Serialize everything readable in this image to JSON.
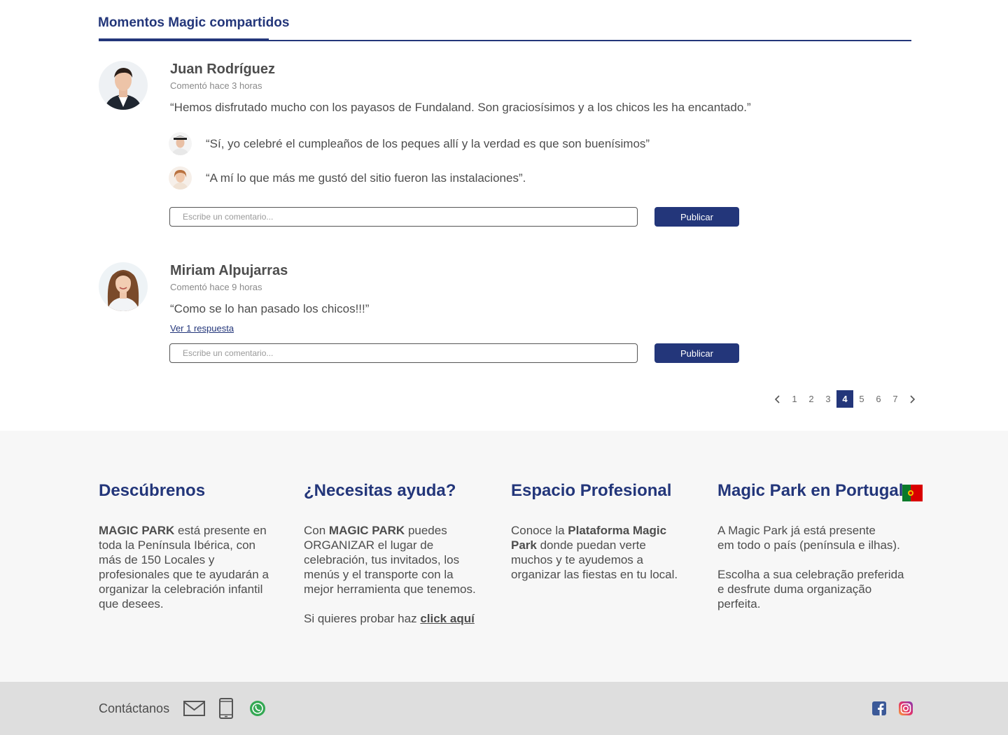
{
  "section": {
    "title": "Momentos Magic compartidos"
  },
  "comments": [
    {
      "author": "Juan Rodríguez",
      "meta": "Comentó hace 3 horas",
      "text": "“Hemos disfrutado mucho con los payasos de Fundaland. Son graciosísimos y a los chicos les ha encantado.”",
      "replies": [
        {
          "text": "“Sí, yo celebré el cumpleaños de los peques allí y la verdad es que son buenísimos”"
        },
        {
          "text": "“A mí lo que más me gustó del sitio fueron las instalaciones”."
        }
      ],
      "input_placeholder": "Escribe un comentario...",
      "publish_label": "Publicar"
    },
    {
      "author": "Miriam Alpujarras",
      "meta": "Comentó hace 9 horas",
      "text": "“Como se lo han pasado los chicos!!!”",
      "reply_link": "Ver 1 respuesta",
      "input_placeholder": "Escribe un comentario...",
      "publish_label": "Publicar"
    }
  ],
  "pagination": {
    "pages": [
      "1",
      "2",
      "3",
      "4",
      "5",
      "6",
      "7"
    ],
    "current": "4",
    "prev": "‹",
    "next": "›"
  },
  "footer": {
    "discover": {
      "title": "Descúbrenos",
      "brand": "MAGIC PARK",
      "text": " está presente en toda la Península Ibérica, con más de 150 Locales y profesionales que te ayudarán a organizar la celebración infantil que desees."
    },
    "help": {
      "title": "¿Necesitas ayuda?",
      "prefix": "Con ",
      "brand": "MAGIC PARK",
      "text": " puedes ORGANIZAR el lugar de celebración, tus invitados, los menús y el transporte con la mejor herramienta que tenemos.",
      "try_prefix": "Si quieres probar haz ",
      "try_link": "click aquí"
    },
    "professional": {
      "title": "Espacio Profesional",
      "prefix": "Conoce la ",
      "brand": "Plataforma Magic Park",
      "text": " donde puedan verte muchos y te ayudemos a organizar las fiestas en tu local."
    },
    "portugal": {
      "title": "Magic Park en Portugal",
      "line1": "A Magic Park já está presente",
      "line2": "em todo o país (península e ilhas).",
      "para2": "Escolha a sua celebração preferida e desfrute duma organização perfeita."
    }
  },
  "bottom": {
    "contact_label": "Contáctanos"
  },
  "colors": {
    "brand_blue": "#23367a",
    "footer_bg": "#f7f7f7",
    "bottom_bg": "#dedede"
  }
}
